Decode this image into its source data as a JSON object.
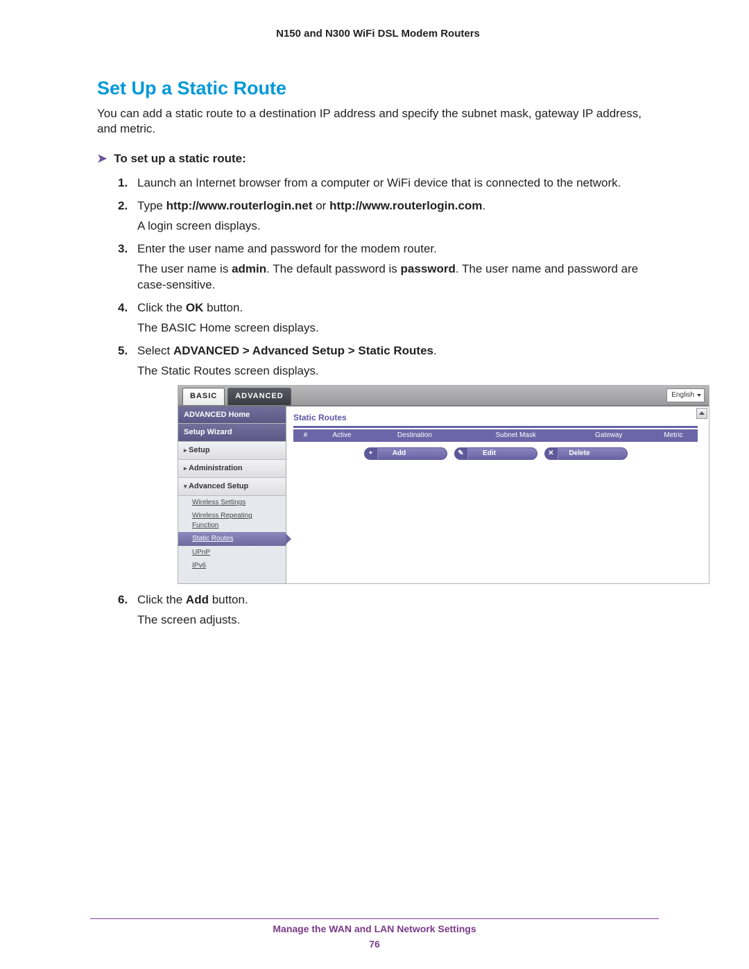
{
  "doc": {
    "header": "N150 and N300 WiFi DSL Modem Routers",
    "heading": "Set Up a Static Route",
    "intro": "You can add a static route to a destination IP address and specify the subnet mask, gateway IP address, and metric.",
    "procedure_title": "To set up a static route:",
    "steps": {
      "s1": "Launch an Internet browser from a computer or WiFi device that is connected to the network.",
      "s2_pre": "Type ",
      "s2_bold": "http://www.routerlogin.net",
      "s2_mid": " or ",
      "s2_bold2": "http://www.routerlogin.com",
      "s2_post": ".",
      "s2_p2": "A login screen displays.",
      "s3": "Enter the user name and password for the modem router.",
      "s3_p2a": "The user name is ",
      "s3_p2_admin": "admin",
      "s3_p2b": ". The default password is ",
      "s3_p2_pwd": "password",
      "s3_p2c": ". The user name and password are case-sensitive.",
      "s4_pre": "Click the ",
      "s4_bold": "OK",
      "s4_post": " button.",
      "s4_p2": "The BASIC Home screen displays.",
      "s5_pre": "Select ",
      "s5_bold": "ADVANCED > Advanced Setup > Static Routes",
      "s5_post": ".",
      "s5_p2": "The Static Routes screen displays.",
      "s6_pre": "Click the ",
      "s6_bold": "Add",
      "s6_post": " button.",
      "s6_p2": "The screen adjusts."
    },
    "footer": "Manage the WAN and LAN Network Settings",
    "page_number": "76"
  },
  "ui": {
    "tabs": {
      "basic": "BASIC",
      "advanced": "ADVANCED"
    },
    "language": "English",
    "sidebar": {
      "advanced_home": "ADVANCED Home",
      "setup_wizard": "Setup Wizard",
      "setup": "Setup",
      "administration": "Administration",
      "advanced_setup": "Advanced Setup",
      "sub": {
        "wireless_settings": "Wireless Settings",
        "wireless_repeating": "Wireless Repeating Function",
        "static_routes": "Static Routes",
        "upnp": "UPnP",
        "ipv6": "IPv6"
      }
    },
    "panel": {
      "title": "Static Routes",
      "cols": {
        "hash": "#",
        "active": "Active",
        "destination": "Destination",
        "subnet": "Subnet Mask",
        "gateway": "Gateway",
        "metric": "Metric"
      },
      "actions": {
        "add": "Add",
        "edit": "Edit",
        "delete": "Delete"
      }
    }
  }
}
